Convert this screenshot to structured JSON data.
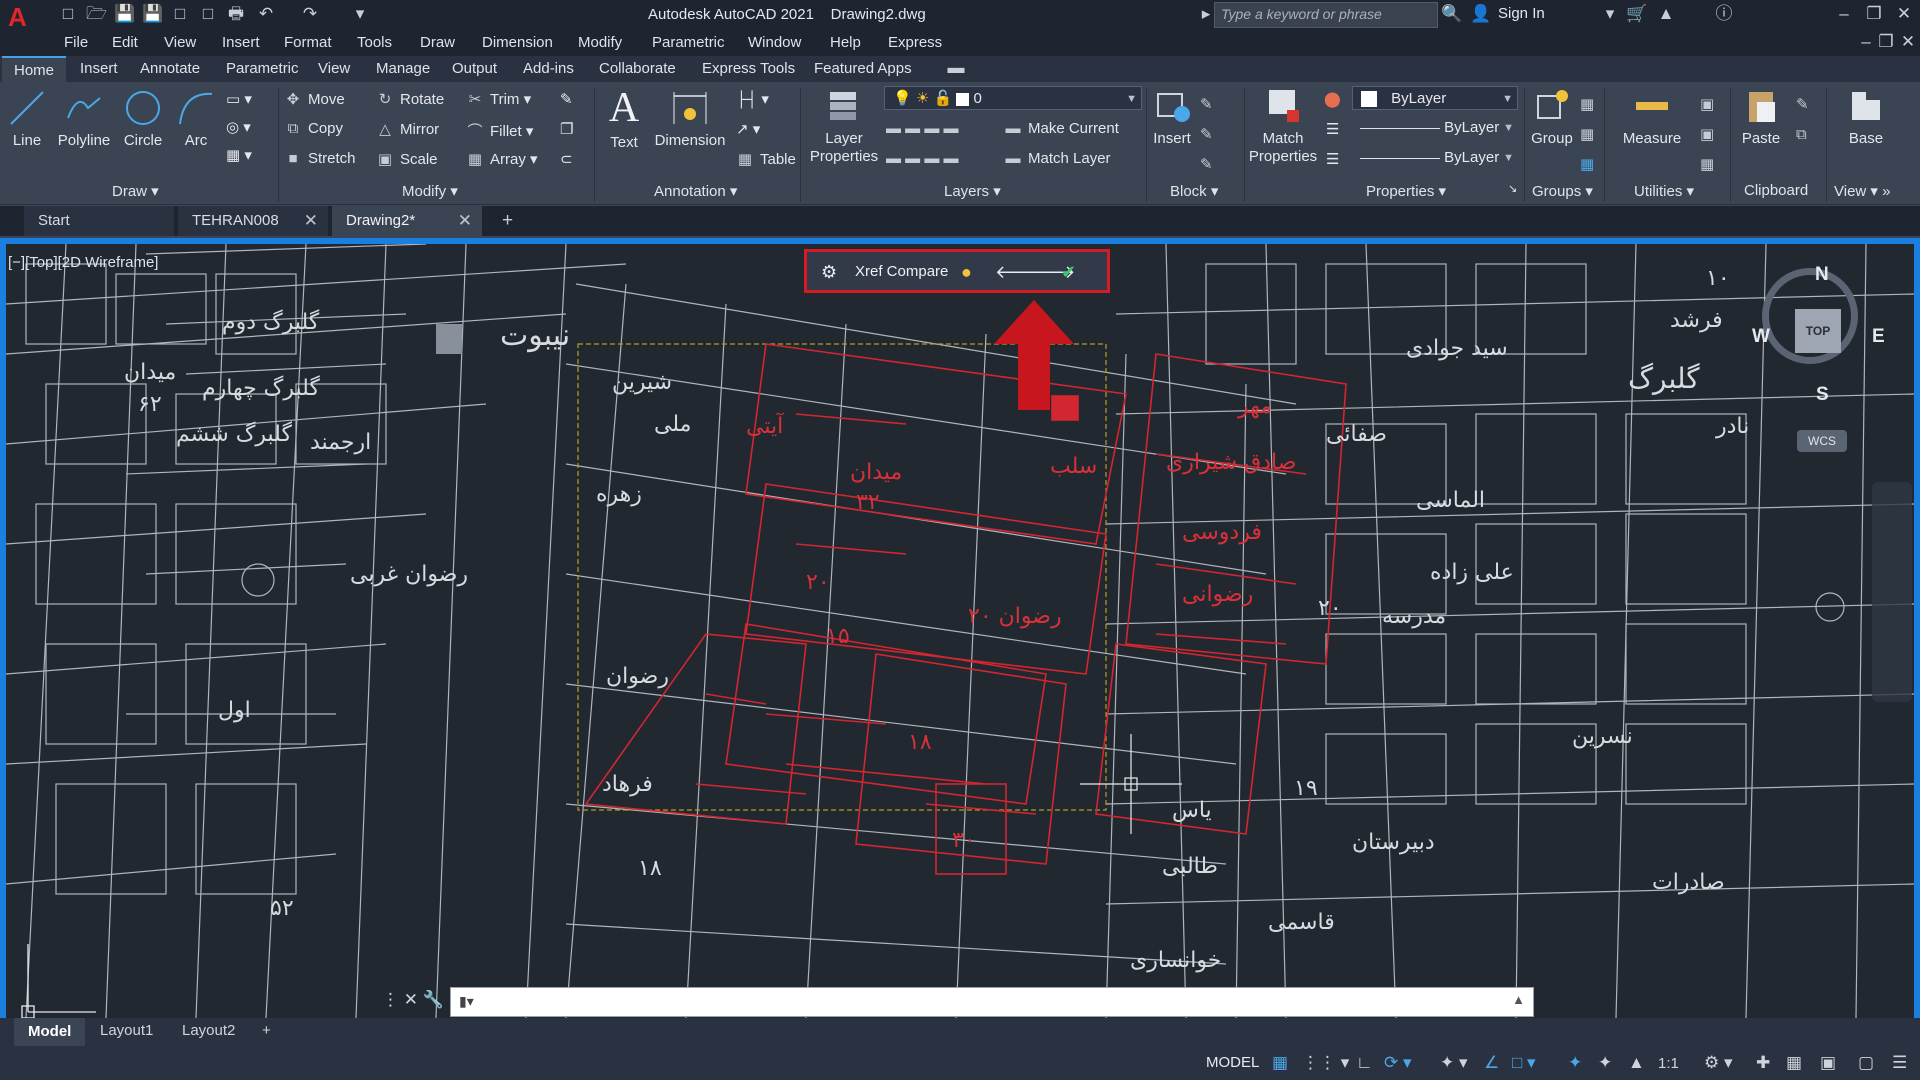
{
  "app": {
    "title": "Autodesk AutoCAD 2021",
    "document": "Drawing2.dwg",
    "search_placeholder": "Type a keyword or phrase",
    "sign_in": "Sign In"
  },
  "menu": [
    "File",
    "Edit",
    "View",
    "Insert",
    "Format",
    "Tools",
    "Draw",
    "Dimension",
    "Modify",
    "Parametric",
    "Window",
    "Help",
    "Express"
  ],
  "ribbon_tabs": [
    "Home",
    "Insert",
    "Annotate",
    "Parametric",
    "View",
    "Manage",
    "Output",
    "Add-ins",
    "Collaborate",
    "Express Tools",
    "Featured Apps"
  ],
  "draw_panel": {
    "title": "Draw",
    "line": "Line",
    "polyline": "Polyline",
    "circle": "Circle",
    "arc": "Arc"
  },
  "modify_panel": {
    "title": "Modify",
    "move": "Move",
    "rotate": "Rotate",
    "trim": "Trim",
    "copy": "Copy",
    "mirror": "Mirror",
    "fillet": "Fillet",
    "stretch": "Stretch",
    "scale": "Scale",
    "array": "Array"
  },
  "annotation_panel": {
    "title": "Annotation",
    "text": "Text",
    "dimension": "Dimension",
    "table": "Table"
  },
  "layers_panel": {
    "title": "Layers",
    "layer_properties": "Layer Properties",
    "current_layer": "0",
    "make_current": "Make Current",
    "match_layer": "Match Layer"
  },
  "block_panel": {
    "title": "Block",
    "insert": "Insert"
  },
  "properties_panel": {
    "title": "Properties",
    "match_properties": "Match Properties",
    "color": "ByLayer",
    "linetype": "ByLayer",
    "lineweight": "ByLayer"
  },
  "groups_panel": {
    "title": "Groups",
    "group": "Group"
  },
  "utilities_panel": {
    "title": "Utilities",
    "measure": "Measure"
  },
  "clipboard_panel": {
    "title": "Clipboard",
    "paste": "Paste"
  },
  "view_panel": {
    "title": "View",
    "base": "Base"
  },
  "file_tabs": [
    "Start",
    "TEHRAN008",
    "Drawing2*"
  ],
  "viewport_label": "[−][Top][2D Wireframe]",
  "xref_compare": {
    "label": "Xref Compare"
  },
  "viewcube": {
    "top": "TOP",
    "n": "N",
    "s": "S",
    "e": "E",
    "w": "W",
    "wcs": "WCS"
  },
  "layout_tabs": [
    "Model",
    "Layout1",
    "Layout2"
  ],
  "status": {
    "model": "MODEL",
    "scale": "1:1"
  },
  "map_labels_white": [
    "میدان",
    "۶۲",
    "گلبرگ دوم",
    "گلبرگ چهارم",
    "گلبرگ ششم",
    "ارجمند",
    "رضوان غربی",
    "رضوان",
    "اول",
    "نیبوت",
    "شیرین",
    "ملی",
    "زهره",
    "فرهاد",
    "فرشد",
    "گلبرگ",
    "نادر",
    "صفائی",
    "الماسی",
    "علی زاده",
    "مدرسه",
    "یاس",
    "دبیرستان",
    "طالبی",
    "قاسمی",
    "خوانساری",
    "سید جوادی",
    "نسرین",
    "صادرات",
    "۱۰",
    "۱۸",
    "۱۹",
    "۵۲",
    "۲۰"
  ],
  "map_labels_red": [
    "آیتی",
    "میدان",
    "۳۲",
    "سلب",
    "مهر",
    "صادق شیرازی",
    "فردوسی",
    "رضوانی",
    "۲۰ رضوان",
    "۲۰",
    "۱۸",
    "۳۰",
    "۱۵"
  ]
}
